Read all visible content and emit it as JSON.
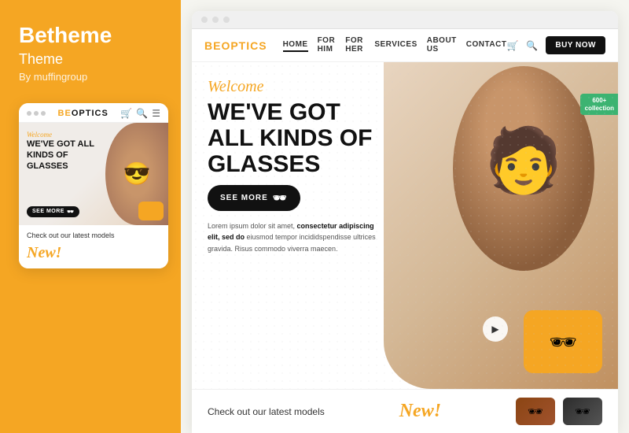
{
  "left": {
    "brand_name": "Betheme",
    "subtitle": "Theme",
    "by": "By muffingroup",
    "mobile": {
      "logo_be": "BE",
      "logo_optics": "OPTICS",
      "welcome": "Welcome",
      "headline": "WE'VE GOT ALL KINDS OF GLASSES",
      "cta": "SEE MORE",
      "check_text": "Check out our latest models",
      "new_text": "New!"
    }
  },
  "right": {
    "titlebar_dots": [
      "",
      "",
      ""
    ],
    "logo_be": "BE",
    "logo_optics": "OPTICS",
    "nav": {
      "items": [
        "HOME",
        "FOR HIM",
        "FOR HER",
        "SERVICES",
        "ABOUT US",
        "CONTACT"
      ],
      "active": "HOME"
    },
    "buy_label": "BUY NOW",
    "hero": {
      "welcome": "Welcome",
      "headline_line1": "WE'VE GOT",
      "headline_line2": "ALL KINDS OF",
      "headline_line3": "GLASSES",
      "cta_label": "SEE MORE",
      "description": "Lorem ipsum dolor sit amet, consectetur adipiscing elit, sed do eiusmod tempor incididspendisse ultrices gravida. Risus commodo viverra maecen.",
      "badge_text": "600+",
      "badge_sub": "collection"
    },
    "bottom": {
      "check_text": "Check out our latest models",
      "new_text": "New!"
    }
  }
}
